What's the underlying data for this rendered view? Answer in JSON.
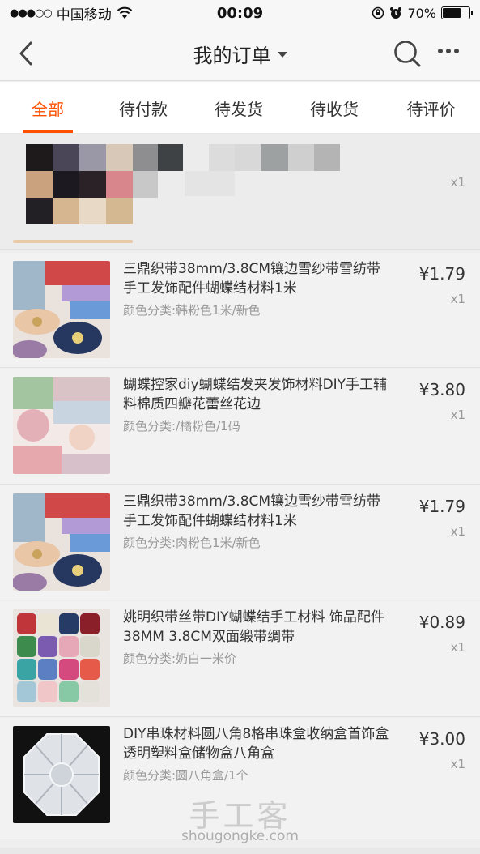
{
  "status_bar": {
    "carrier": "中国移动",
    "time": "00:09",
    "battery": "70%",
    "battery_level": 0.7
  },
  "nav": {
    "title": "我的订单"
  },
  "tabs": [
    {
      "label": "全部",
      "active": true
    },
    {
      "label": "待付款",
      "active": false
    },
    {
      "label": "待发货",
      "active": false
    },
    {
      "label": "待收货",
      "active": false
    },
    {
      "label": "待评价",
      "active": false
    }
  ],
  "first_item": {
    "qty": "x1"
  },
  "items": [
    {
      "title": "三鼎织带38mm/3.8CM镶边雪纱带雪纺带 手工发饰配件蝴蝶结材料1米",
      "sku": "颜色分类:韩粉色1米/新色",
      "price": "¥1.79",
      "qty": "x1"
    },
    {
      "title": "蝴蝶控家diy蝴蝶结发夹发饰材料DIY手工辅料棉质四瓣花蕾丝花边",
      "sku": "颜色分类:/橘粉色/1码",
      "price": "¥3.80",
      "qty": "x1"
    },
    {
      "title": "三鼎织带38mm/3.8CM镶边雪纱带雪纺带 手工发饰配件蝴蝶结材料1米",
      "sku": "颜色分类:肉粉色1米/新色",
      "price": "¥1.79",
      "qty": "x1"
    },
    {
      "title": "姚明织带丝带DIY蝴蝶结手工材料 饰品配件38MM 3.8CM双面缎带绸带",
      "sku": "颜色分类:奶白一米价",
      "price": "¥0.89",
      "qty": "x1"
    },
    {
      "title": "DIY串珠材料圆八角8格串珠盒收纳盒首饰盒透明塑料盒储物盒八角盒",
      "sku": "颜色分类:圆八角盒/1个",
      "price": "¥3.00",
      "qty": "x1"
    }
  ],
  "watermark": {
    "cn": "手工客",
    "en": "shougongke.com"
  }
}
